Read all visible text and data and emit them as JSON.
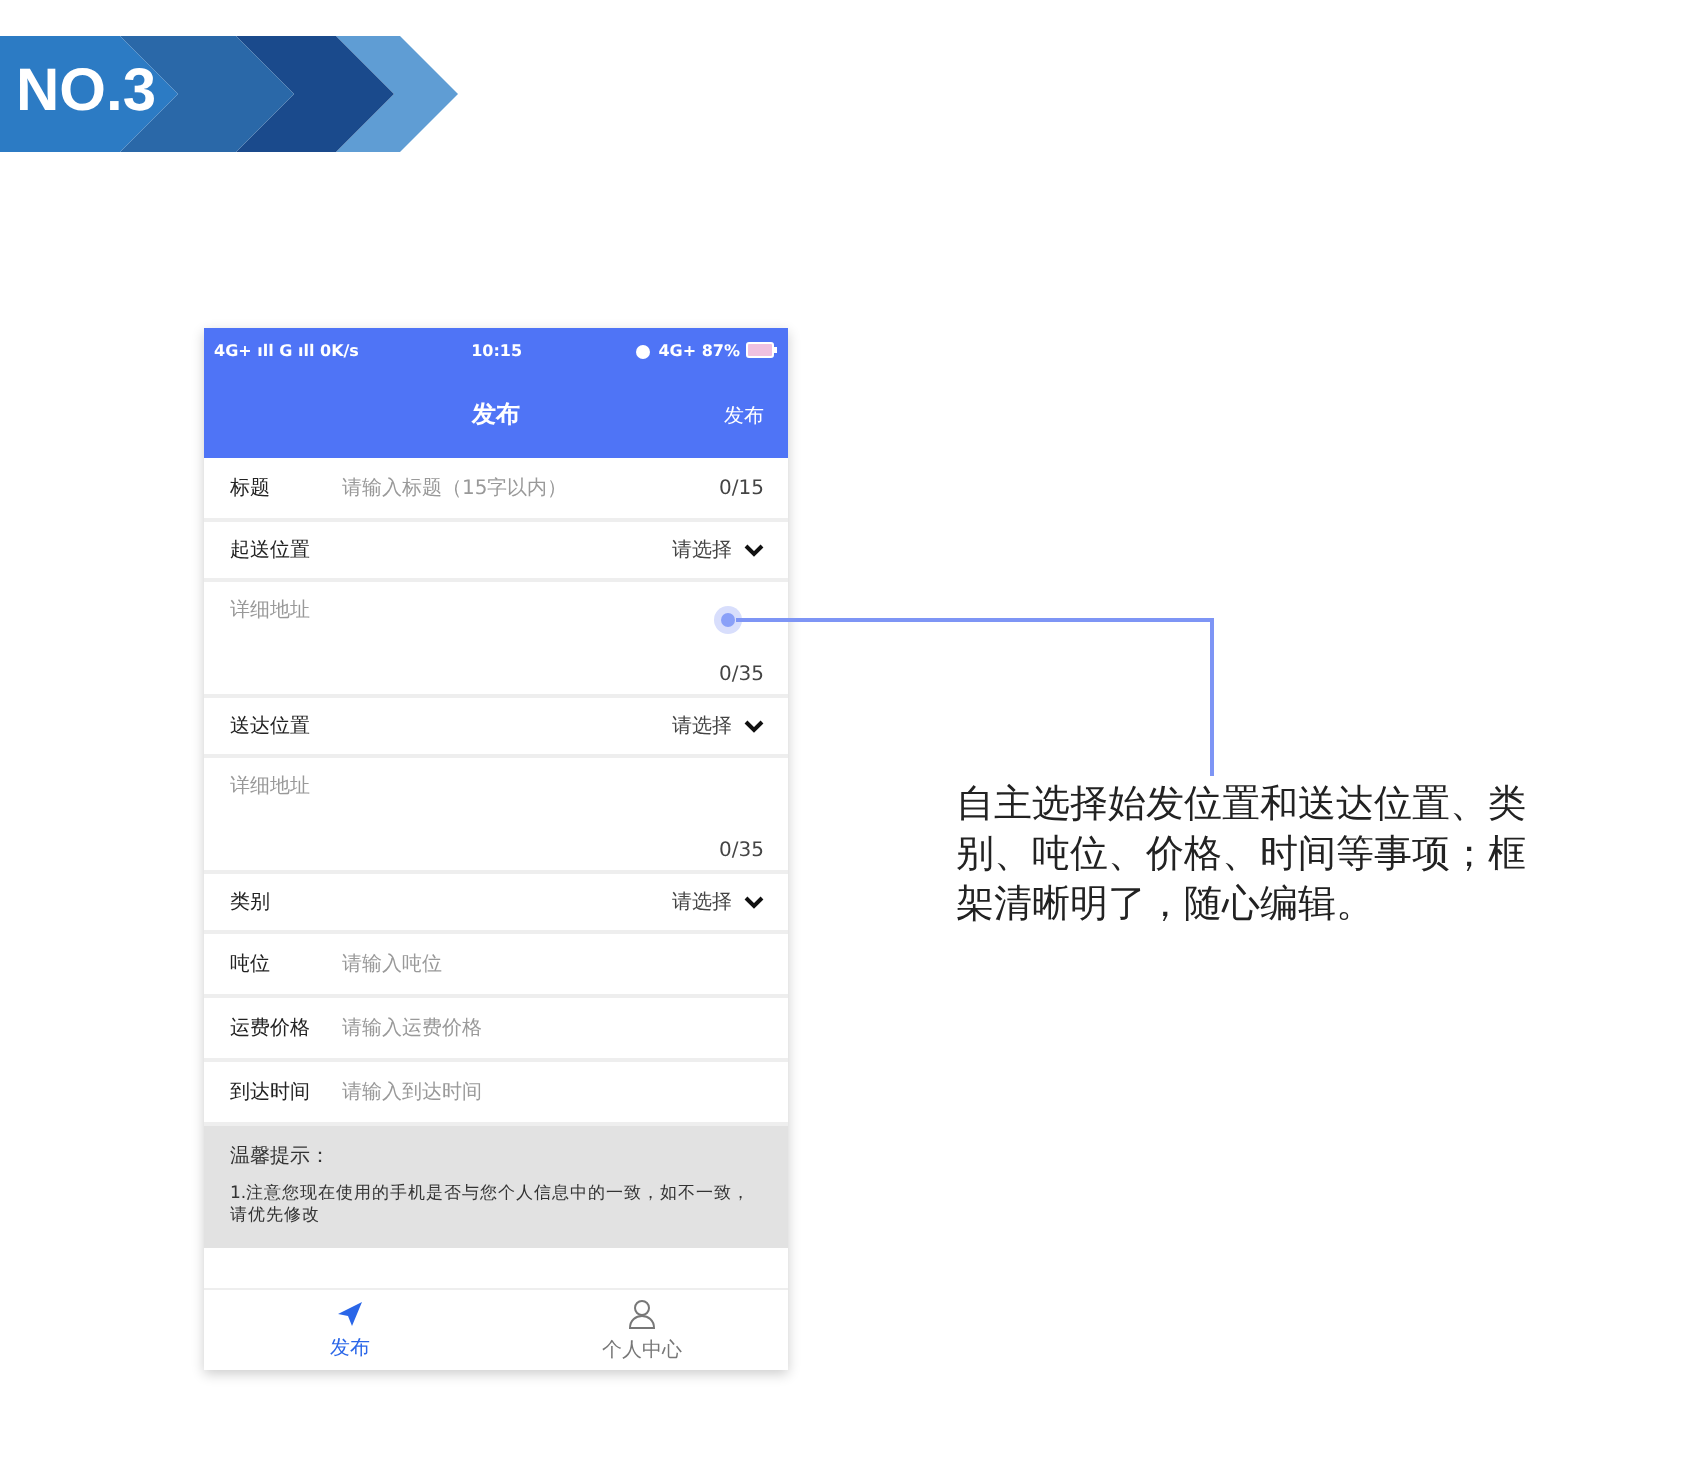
{
  "banner": {
    "label": "NO.3"
  },
  "status_bar": {
    "left": "4G+ ıll G ıll 0K/s",
    "time": "10:15",
    "right": "4G+ 87%"
  },
  "header": {
    "title": "发布",
    "action": "发布"
  },
  "form": [
    {
      "kind": "input",
      "label": "标题",
      "placeholder": "请输入标题（15字以内）",
      "counter": "0/15"
    },
    {
      "kind": "select",
      "label": "起送位置",
      "value": "请选择"
    },
    {
      "kind": "textarea",
      "placeholder": "详细地址",
      "counter": "0/35"
    },
    {
      "kind": "select",
      "label": "送达位置",
      "value": "请选择"
    },
    {
      "kind": "textarea",
      "placeholder": "详细地址",
      "counter": "0/35"
    },
    {
      "kind": "select",
      "label": "类别",
      "value": "请选择"
    },
    {
      "kind": "input",
      "label": "吨位",
      "placeholder": "请输入吨位"
    },
    {
      "kind": "input",
      "label": "运费价格",
      "placeholder": "请输入运费价格"
    },
    {
      "kind": "input",
      "label": "到达时间",
      "placeholder": "请输入到达时间"
    }
  ],
  "notice": {
    "title": "温馨提示：",
    "text": "1.注意您现在使用的手机是否与您个人信息中的一致，如不一致，请优先修改"
  },
  "tabs": [
    {
      "label": "发布",
      "kind": "send",
      "selected": true
    },
    {
      "label": "个人中心",
      "kind": "person",
      "selected": false
    }
  ],
  "callout": {
    "text": "自主选择始发位置和送达位置、类别、吨位、价格、时间等事项；框架清晰明了，随心编辑。"
  }
}
